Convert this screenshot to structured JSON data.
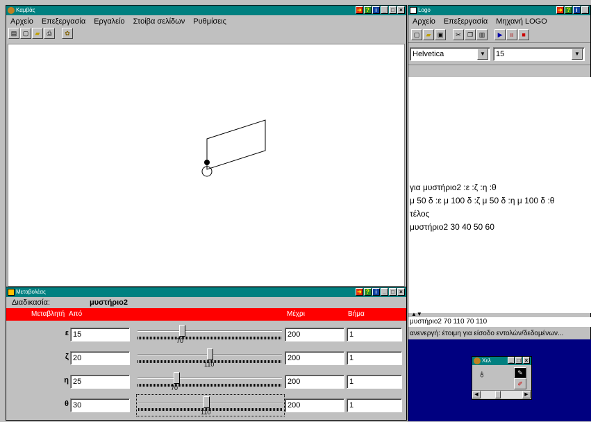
{
  "canvas_window": {
    "title": "Καμβάς",
    "menu": [
      "Αρχείο",
      "Επεξεργασία",
      "Εργαλείο",
      "Στοίβα σελίδων",
      "Ρυθμίσεις"
    ]
  },
  "logo_window": {
    "title": "Logo",
    "menu": [
      "Αρχείο",
      "Επεξεργασία",
      "Μηχανή LOGO"
    ],
    "font": "Helvetica",
    "font_size": "15",
    "editor_lines": [
      "για μυστήριο2 :ε :ζ :η :θ",
      "μ 50 δ :ε μ 100 δ :ζ μ 50 δ :η μ 100 δ :θ",
      "τέλος",
      "μυστήριο2 30 40 50 60"
    ],
    "command": "μυστήριο2 70 110 70 110",
    "status": "ανενεργή: έτοιμη για είσοδο εντολών/δεδομένων..."
  },
  "variation_window": {
    "title": "Μεταβολέας",
    "procedure_label": "Διαδικασία:",
    "procedure": "μυστήριο2",
    "headers": {
      "variable": "Μεταβλητή",
      "from": "Από",
      "to": "Μέχρι",
      "step": "Βήμα"
    },
    "rows": [
      {
        "name": "ε",
        "from": "15",
        "value": "70",
        "to": "200",
        "step": "1",
        "level": 0.3
      },
      {
        "name": "ζ",
        "from": "20",
        "value": "110",
        "to": "200",
        "step": "1",
        "level": 0.5
      },
      {
        "name": "η",
        "from": "25",
        "value": "70",
        "to": "200",
        "step": "1",
        "level": 0.26
      },
      {
        "name": "θ",
        "from": "30",
        "value": "110",
        "to": "200",
        "step": "1",
        "level": 0.47
      }
    ]
  },
  "turtle_window": {
    "title": "Χελ"
  }
}
